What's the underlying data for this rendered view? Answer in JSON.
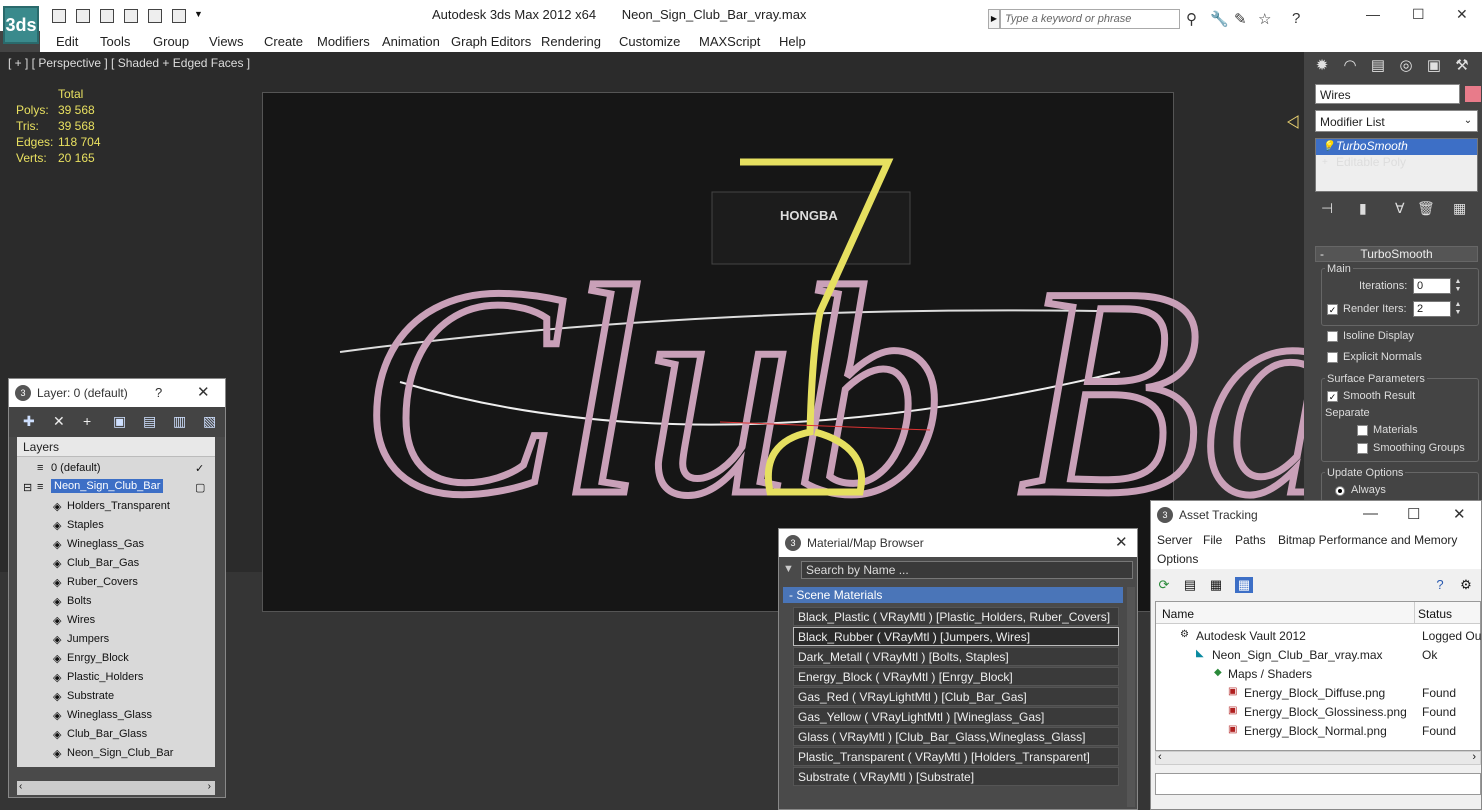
{
  "titlebar": {
    "app_logo": "3ds",
    "app_title": "Autodesk 3ds Max  2012 x64",
    "file_name": "Neon_Sign_Club_Bar_vray.max",
    "search_placeholder": "Type a keyword or phrase"
  },
  "menu": [
    "Edit",
    "Tools",
    "Group",
    "Views",
    "Create",
    "Modifiers",
    "Animation",
    "Graph Editors",
    "Rendering",
    "Customize",
    "MAXScript",
    "Help"
  ],
  "viewport": {
    "label": "[ + ] [ Perspective ] [ Shaded + Edged Faces ]",
    "stats": {
      "header": "Total",
      "polys_label": "Polys:",
      "polys": "39 568",
      "tris_label": "Tris:",
      "tris": "39 568",
      "edges_label": "Edges:",
      "edges": "118 704",
      "verts_label": "Verts:",
      "verts": "20 165"
    },
    "sign_text": "Club Bar",
    "plate_text": "HONGBA"
  },
  "command_panel": {
    "object_name": "Wires",
    "object_color": "#e87b8a",
    "modifier_list": "Modifier List",
    "stack": [
      "TurboSmooth",
      "Editable Poly"
    ],
    "rollout_title": "TurboSmooth",
    "main_label": "Main",
    "iterations_label": "Iterations:",
    "iterations": "0",
    "render_iters_label": "Render Iters:",
    "render_iters": "2",
    "isoline": "Isoline Display",
    "explicit": "Explicit Normals",
    "surface_params": "Surface Parameters",
    "smooth_result": "Smooth Result",
    "separate": "Separate",
    "materials": "Materials",
    "smoothing_groups": "Smoothing Groups",
    "update_options": "Update Options",
    "always": "Always"
  },
  "layer_window": {
    "title": "Layer: 0 (default)",
    "help": "?",
    "header": "Layers",
    "default_layer": "0 (default)",
    "selected_layer": "Neon_Sign_Club_Bar",
    "objects": [
      "Holders_Transparent",
      "Staples",
      "Wineglass_Gas",
      "Club_Bar_Gas",
      "Ruber_Covers",
      "Bolts",
      "Wires",
      "Jumpers",
      "Enrgy_Block",
      "Plastic_Holders",
      "Substrate",
      "Wineglass_Glass",
      "Club_Bar_Glass",
      "Neon_Sign_Club_Bar"
    ]
  },
  "material_browser": {
    "title": "Material/Map Browser",
    "search_placeholder": "Search by Name ...",
    "section": "- Scene Materials",
    "materials": [
      "Black_Plastic  ( VRayMtl )  [Plastic_Holders, Ruber_Covers]",
      "Black_Rubber  ( VRayMtl )  [Jumpers, Wires]",
      "Dark_Metall  ( VRayMtl )  [Bolts, Staples]",
      "Energy_Block  ( VRayMtl )  [Enrgy_Block]",
      "Gas_Red  ( VRayLightMtl )  [Club_Bar_Gas]",
      "Gas_Yellow  ( VRayLightMtl )  [Wineglass_Gas]",
      "Glass  ( VRayMtl )  [Club_Bar_Glass,Wineglass_Glass]",
      "Plastic_Transparent  ( VRayMtl )  [Holders_Transparent]",
      "Substrate  ( VRayMtl )  [Substrate]"
    ]
  },
  "asset_tracking": {
    "title": "Asset Tracking",
    "menu": [
      "Server",
      "File",
      "Paths",
      "Bitmap Performance and Memory",
      "Options"
    ],
    "col_name": "Name",
    "col_status": "Status",
    "rows": [
      {
        "name": "Autodesk Vault 2012",
        "status": "Logged Ou"
      },
      {
        "name": "Neon_Sign_Club_Bar_vray.max",
        "status": "Ok"
      },
      {
        "name": "Maps / Shaders",
        "status": ""
      },
      {
        "name": "Energy_Block_Diffuse.png",
        "status": "Found"
      },
      {
        "name": "Energy_Block_Glossiness.png",
        "status": "Found"
      },
      {
        "name": "Energy_Block_Normal.png",
        "status": "Found"
      }
    ]
  }
}
